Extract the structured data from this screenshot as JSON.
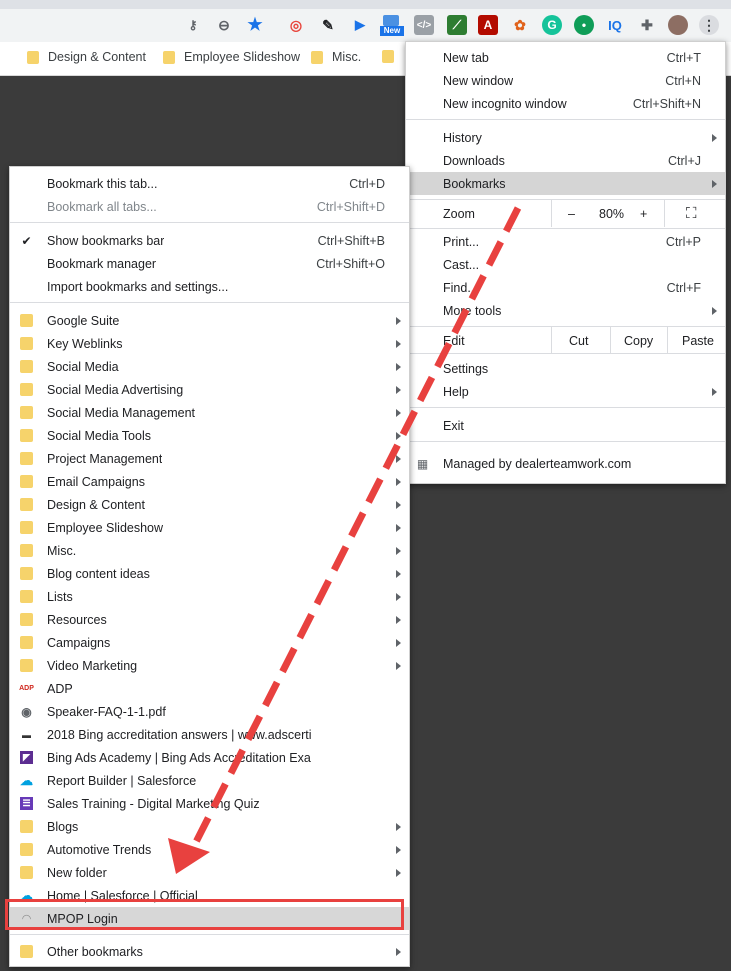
{
  "toolbar": {
    "extensions": [
      "key-icon",
      "zoom-icon",
      "star-icon",
      "ext-1",
      "pen-icon",
      "ext-arrow",
      "ext-new",
      "code-icon",
      "ext-green",
      "pdf-icon",
      "ext-berry",
      "grammarly-icon",
      "hangout-icon",
      "iq-icon",
      "puzzle-icon",
      "avatar",
      "more-icon"
    ],
    "new_badge": "New",
    "iq_label": "IQ",
    "pdf_label": "A"
  },
  "bookmarks_bar": [
    "Design & Content",
    "Employee Slideshow",
    "Misc."
  ],
  "chrome_menu": {
    "new_tab": "New tab",
    "new_tab_sc": "Ctrl+T",
    "new_window": "New window",
    "new_window_sc": "Ctrl+N",
    "incognito": "New incognito window",
    "incognito_sc": "Ctrl+Shift+N",
    "history": "History",
    "downloads": "Downloads",
    "downloads_sc": "Ctrl+J",
    "bookmarks": "Bookmarks",
    "zoom": "Zoom",
    "zoom_minus": "–",
    "zoom_value": "80%",
    "zoom_plus": "+",
    "print": "Print...",
    "print_sc": "Ctrl+P",
    "cast": "Cast...",
    "find": "Find...",
    "find_sc": "Ctrl+F",
    "more_tools": "More tools",
    "edit": "Edit",
    "cut": "Cut",
    "copy": "Copy",
    "paste": "Paste",
    "settings": "Settings",
    "help": "Help",
    "exit": "Exit",
    "managed": "Managed by dealerteamwork.com"
  },
  "bm_menu": {
    "bookmark_tab": "Bookmark this tab...",
    "bookmark_tab_sc": "Ctrl+D",
    "bookmark_all": "Bookmark all tabs...",
    "bookmark_all_sc": "Ctrl+Shift+D",
    "show_bar": "Show bookmarks bar",
    "show_bar_sc": "Ctrl+Shift+B",
    "manager": "Bookmark manager",
    "manager_sc": "Ctrl+Shift+O",
    "import": "Import bookmarks and settings...",
    "items": [
      {
        "label": "Google Suite",
        "icon": "folder",
        "sub": true
      },
      {
        "label": "Key Weblinks",
        "icon": "folder",
        "sub": true
      },
      {
        "label": "Social Media",
        "icon": "folder",
        "sub": true
      },
      {
        "label": "Social Media Advertising",
        "icon": "folder",
        "sub": true
      },
      {
        "label": "Social Media Management",
        "icon": "folder",
        "sub": true
      },
      {
        "label": "Social Media Tools",
        "icon": "folder",
        "sub": true
      },
      {
        "label": "Project Management",
        "icon": "folder",
        "sub": true
      },
      {
        "label": "Email Campaigns",
        "icon": "folder",
        "sub": true
      },
      {
        "label": "Design & Content",
        "icon": "folder",
        "sub": true
      },
      {
        "label": "Employee Slideshow",
        "icon": "folder",
        "sub": true
      },
      {
        "label": "Misc.",
        "icon": "folder",
        "sub": true
      },
      {
        "label": "Blog content ideas",
        "icon": "folder",
        "sub": true
      },
      {
        "label": "Lists",
        "icon": "folder",
        "sub": true
      },
      {
        "label": "Resources",
        "icon": "folder",
        "sub": true
      },
      {
        "label": "Campaigns",
        "icon": "folder",
        "sub": true
      },
      {
        "label": "Video Marketing",
        "icon": "folder",
        "sub": true
      },
      {
        "label": "ADP",
        "icon": "adp",
        "sub": false
      },
      {
        "label": "Speaker-FAQ-1-1.pdf",
        "icon": "globe",
        "sub": false
      },
      {
        "label": "2018 Bing accreditation answers | www.adscerti...",
        "icon": "site",
        "sub": false
      },
      {
        "label": "Bing Ads Academy | Bing Ads Accreditation Exa...",
        "icon": "bing",
        "sub": false
      },
      {
        "label": "Report Builder | Salesforce",
        "icon": "salesforce",
        "sub": false
      },
      {
        "label": "Sales Training - Digital Marketing Quiz",
        "icon": "forms",
        "sub": false
      },
      {
        "label": "Blogs",
        "icon": "folder",
        "sub": true
      },
      {
        "label": "Automotive Trends",
        "icon": "folder",
        "sub": true
      },
      {
        "label": "New folder",
        "icon": "folder",
        "sub": true
      },
      {
        "label": "Home | Salesforce | Official",
        "icon": "salesforce",
        "sub": false
      }
    ],
    "mpop": "MPOP Login",
    "other": "Other bookmarks"
  },
  "colors": {
    "highlight": "#e8413f",
    "menu_hover": "#d6d6d6"
  }
}
